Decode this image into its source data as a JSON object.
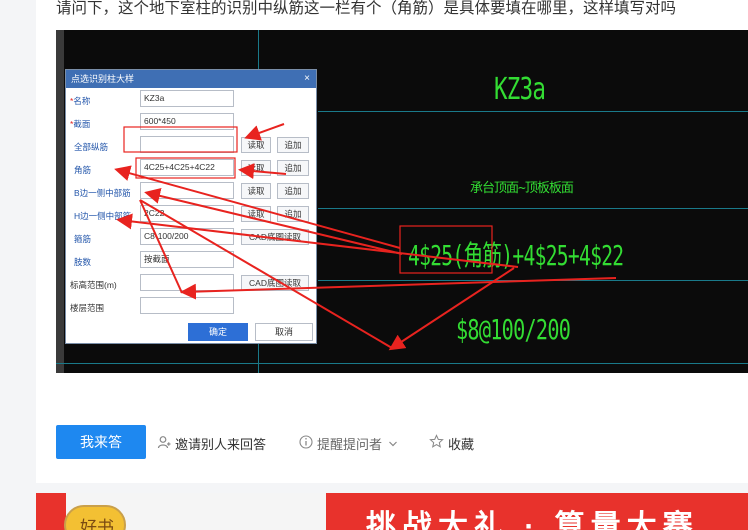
{
  "question": {
    "text": "请问下，这个地下室柱的识别中纵筋这一栏有个（角筋）是具体要填在哪里，这样填写对吗"
  },
  "dialog": {
    "title": "点选识别柱大样",
    "close_icon": "×",
    "fields": [
      {
        "label": "名称",
        "required": true,
        "value": "KZ3a"
      },
      {
        "label": "截面",
        "required": true,
        "value": "600*450"
      },
      {
        "label": "全部纵筋",
        "required": false,
        "value": "",
        "read_button": "读取",
        "add_button": "追加"
      },
      {
        "label": "角筋",
        "required": false,
        "value": "4C25+4C25+4C22",
        "read_button": "读取",
        "add_button": "追加"
      },
      {
        "label": "B边一侧中部筋",
        "required": false,
        "value": "",
        "read_button": "读取",
        "add_button": "追加"
      },
      {
        "label": "H边一侧中部筋",
        "required": false,
        "value": "2C22",
        "read_button": "读取",
        "add_button": "追加"
      },
      {
        "label": "箍筋",
        "required": false,
        "value": "C8-100/200",
        "cad_button": "CAD底图读取"
      },
      {
        "label": "肢数",
        "required": false,
        "value": "按截面"
      },
      {
        "label": "标高范围(m)",
        "required": false,
        "value": "",
        "cad_button": "CAD底图读取"
      },
      {
        "label": "楼层范围",
        "required": false,
        "value": ""
      }
    ],
    "confirm_label": "确定",
    "cancel_label": "取消"
  },
  "cad": {
    "column_name": "KZ3a",
    "elevation_text": "承台顶面~顶板板面",
    "rebar_text": "4$25(角筋)+4$25+4$22",
    "stirrup_text": "$8@100/200",
    "colors": {
      "text": "#33dd33",
      "grid": "#1a7a8a",
      "background": "#0b0b0b",
      "annotation": "#e8231f"
    }
  },
  "actions": {
    "answer_label": "我来答",
    "invite_label": "邀请别人来回答",
    "remind_label": "提醒提问者",
    "favorite_label": "收藏",
    "icons": [
      "user-icon",
      "info-icon",
      "chevron-down-icon",
      "star-icon"
    ]
  },
  "banner": {
    "badge_text": "好书",
    "slogan": "挑战大礼 · 算量大赛"
  }
}
